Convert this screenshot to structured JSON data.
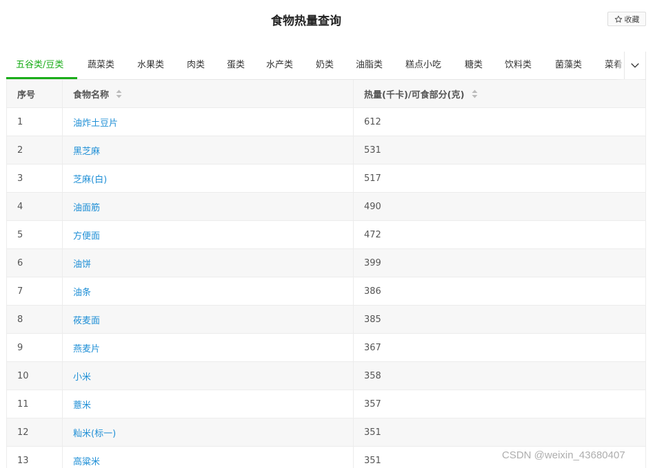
{
  "header": {
    "title": "食物热量查询",
    "favorite_label": "收藏"
  },
  "tabs": [
    {
      "label": "五谷类/豆类",
      "active": true
    },
    {
      "label": "蔬菜类"
    },
    {
      "label": "水果类"
    },
    {
      "label": "肉类"
    },
    {
      "label": "蛋类"
    },
    {
      "label": "水产类"
    },
    {
      "label": "奶类"
    },
    {
      "label": "油脂类"
    },
    {
      "label": "糕点小吃"
    },
    {
      "label": "糖类"
    },
    {
      "label": "饮料类"
    },
    {
      "label": "菌藻类"
    },
    {
      "label": "菜肴"
    }
  ],
  "table": {
    "columns": [
      "序号",
      "食物名称",
      "热量(千卡)/可食部分(克)"
    ],
    "rows": [
      {
        "index": "1",
        "name": "油炸土豆片",
        "calories": "612"
      },
      {
        "index": "2",
        "name": "黑芝麻",
        "calories": "531"
      },
      {
        "index": "3",
        "name": "芝麻(白)",
        "calories": "517"
      },
      {
        "index": "4",
        "name": "油面筋",
        "calories": "490"
      },
      {
        "index": "5",
        "name": "方便面",
        "calories": "472"
      },
      {
        "index": "6",
        "name": "油饼",
        "calories": "399"
      },
      {
        "index": "7",
        "name": "油条",
        "calories": "386"
      },
      {
        "index": "8",
        "name": "莜麦面",
        "calories": "385"
      },
      {
        "index": "9",
        "name": "燕麦片",
        "calories": "367"
      },
      {
        "index": "10",
        "name": "小米",
        "calories": "358"
      },
      {
        "index": "11",
        "name": "薏米",
        "calories": "357"
      },
      {
        "index": "12",
        "name": "籼米(标一)",
        "calories": "351"
      },
      {
        "index": "13",
        "name": "高粱米",
        "calories": "351"
      }
    ]
  },
  "watermark": "CSDN @weixin_43680407",
  "colors": {
    "accent": "#1aad19",
    "link": "#1f8fd6",
    "stripe": "#f7f7f7",
    "border": "#ececec"
  },
  "icons": {
    "favorite": "star-outline-icon",
    "expand": "chevron-down-icon",
    "sort": "sort-updown-icon"
  }
}
